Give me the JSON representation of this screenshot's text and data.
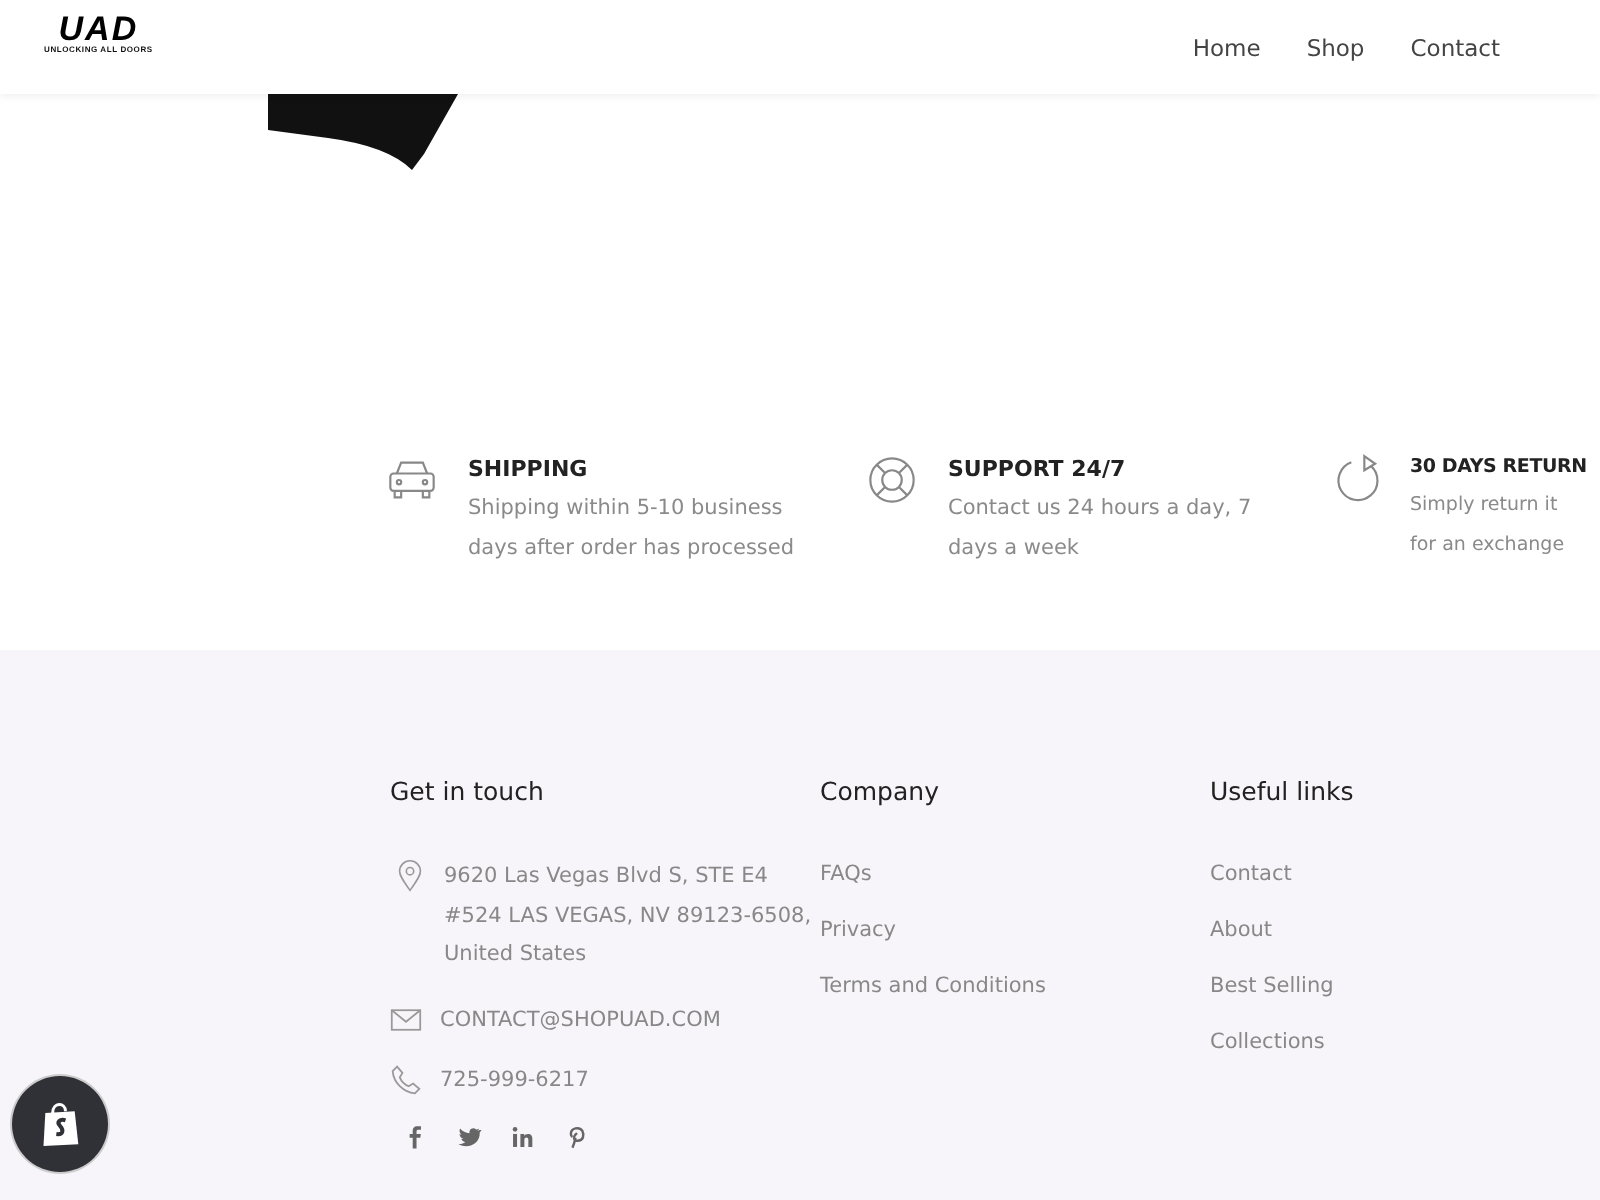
{
  "header": {
    "logo": "UAD",
    "tagline": "UNLOCKING ALL DOORS",
    "nav": [
      {
        "label": "Home"
      },
      {
        "label": "Shop"
      },
      {
        "label": "Contact"
      }
    ]
  },
  "features": [
    {
      "kind": "car",
      "title": "SHIPPING",
      "text": "Shipping within 5-10 business days after order has processed"
    },
    {
      "kind": "lifebuoy",
      "title": "SUPPORT 24/7",
      "text": "Contact us 24 hours a day, 7 days a week"
    },
    {
      "kind": "return",
      "title": "30 DAYS RETURN",
      "text": "Simply return it for an exchange"
    }
  ],
  "footer": {
    "contact": {
      "heading": "Get in touch",
      "address": "9620 Las Vegas Blvd S, STE E4 #524 LAS VEGAS, NV 89123-6508, United States",
      "email": "CONTACT@SHOPUAD.COM",
      "phone": "725-999-6217"
    },
    "columns": [
      {
        "heading": "Company",
        "links": [
          "FAQs",
          "Privacy",
          "Terms and Conditions"
        ]
      },
      {
        "heading": "Useful links",
        "links": [
          "Contact",
          "About",
          "Best Selling",
          "Collections"
        ]
      }
    ]
  }
}
